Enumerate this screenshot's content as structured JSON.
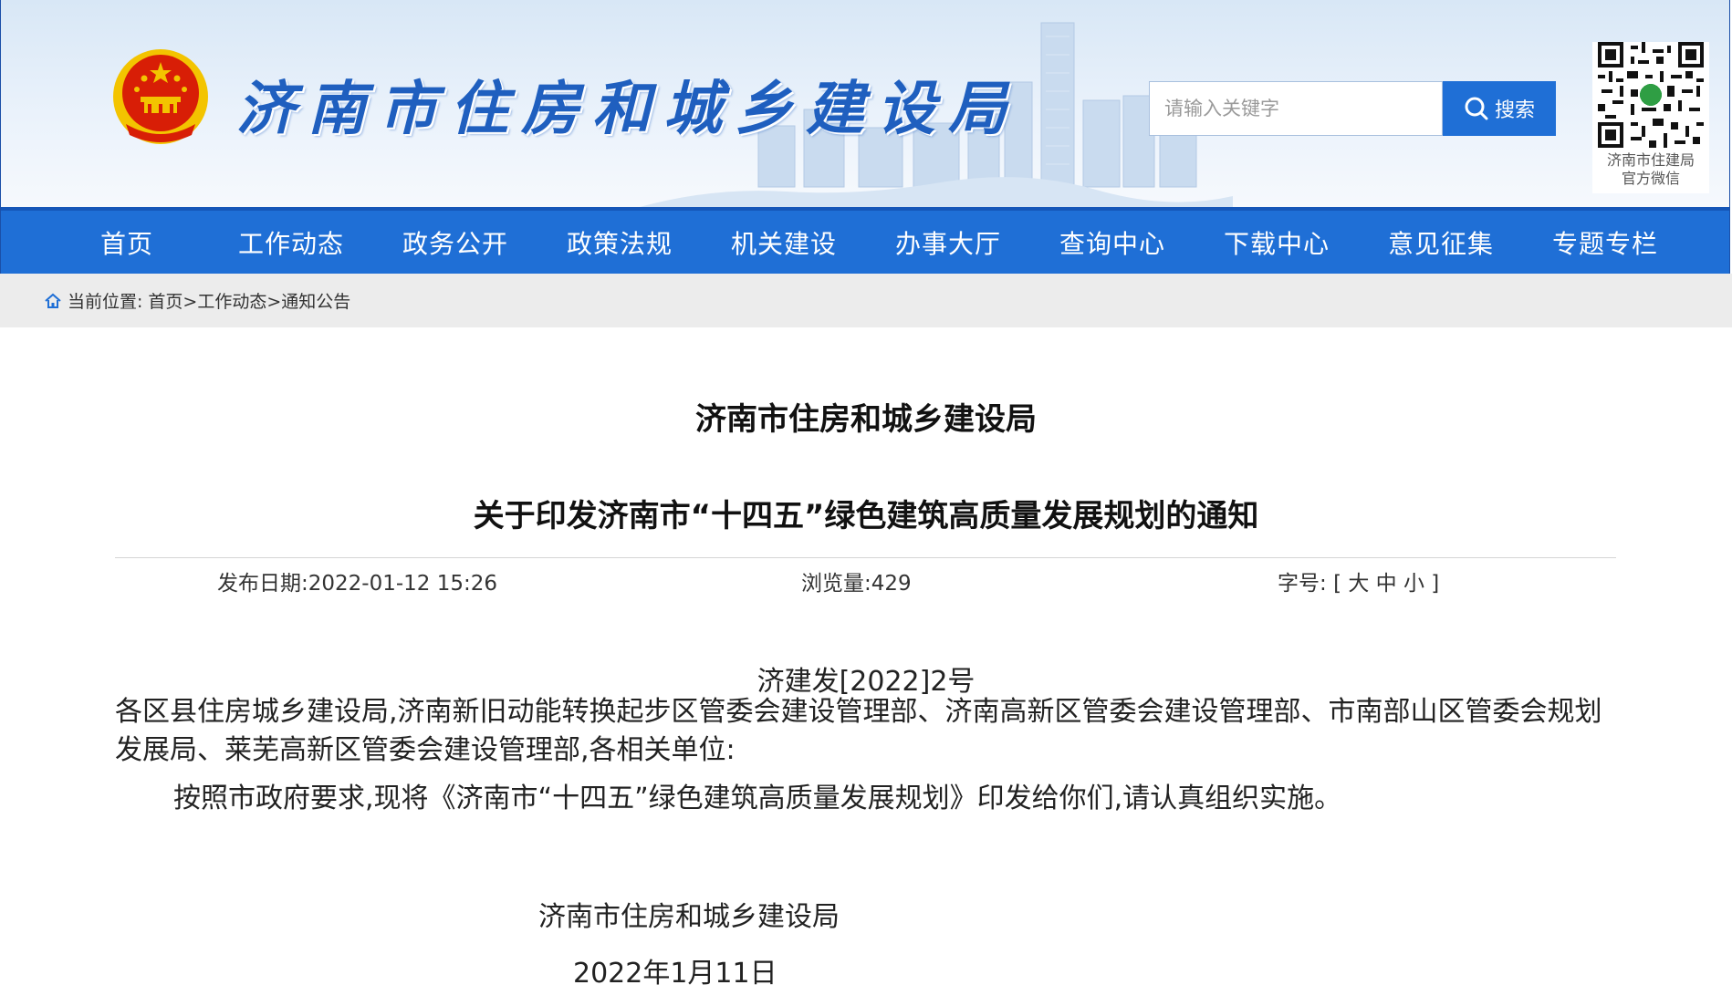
{
  "header": {
    "site_title": "济南市住房和城乡建设局",
    "search": {
      "placeholder": "请输入关键字",
      "button_label": "搜索"
    },
    "qr_caption_line1": "济南市住建局",
    "qr_caption_line2": "官方微信"
  },
  "nav": {
    "items": [
      "首页",
      "工作动态",
      "政务公开",
      "政策法规",
      "机关建设",
      "办事大厅",
      "查询中心",
      "下载中心",
      "意见征集",
      "专题专栏"
    ]
  },
  "breadcrumb": {
    "label": "当前位置:",
    "items": [
      "首页",
      "工作动态",
      "通知公告"
    ],
    "separator": ">"
  },
  "article": {
    "org": "济南市住房和城乡建设局",
    "title": "关于印发济南市“十四五”绿色建筑高质量发展规划的通知",
    "publish_label": "发布日期:",
    "publish_date": "2022-01-12 15:26",
    "views_label": "浏览量:",
    "views": "429",
    "fontsize_label": "字号:",
    "fontsize_open": "[",
    "fontsize_large": "大",
    "fontsize_medium": "中",
    "fontsize_small": "小",
    "fontsize_close": "]",
    "doc_number": "济建发[2022]2号",
    "recipients": "各区县住房城乡建设局,济南新旧动能转换起步区管委会建设管理部、济南高新区管委会建设管理部、市南部山区管委会规划发展局、莱芜高新区管委会建设管理部,各相关单位:",
    "body": "按照市政府要求,现将《济南市“十四五”绿色建筑高质量发展规划》印发给你们,请认真组织实施。",
    "signature": "济南市住房和城乡建设局",
    "date": "2022年1月11日"
  },
  "colors": {
    "nav_blue": "#1f6fd6",
    "title_blue": "#1f5fbf",
    "emblem_red": "#d81e06",
    "emblem_gold": "#f3c400"
  }
}
